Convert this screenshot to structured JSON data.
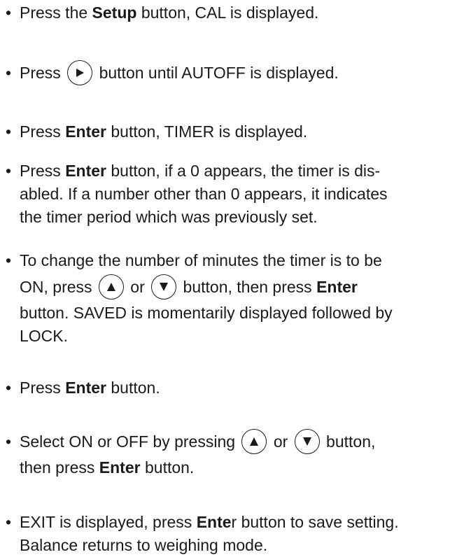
{
  "steps": [
    {
      "a": "Press the ",
      "b": "Setup",
      "c": " button, CAL is displayed."
    },
    {
      "a": "Press ",
      "icon": "right-arrow-icon",
      "c": " button until AUTOFF is displayed."
    },
    {
      "a": "Press ",
      "b": "Enter",
      "c": " button, TIMER is displayed."
    },
    {
      "a": "Press ",
      "b": "Enter",
      "c": " button, if a 0 appears, the timer is  dis-",
      "l2": "abled.  If a number other than 0 appears, it indicates",
      "l3": "the timer period which was previously set."
    },
    {
      "l1": "To change the number of minutes the timer is to be",
      "l2a": "ON, press ",
      "or": " or ",
      "l2c": " button, then press ",
      "l2b": "Enter",
      "l3": "button.  SAVED is momentarily displayed followed by",
      "l4": "LOCK."
    },
    {
      "a": "Press ",
      "b": "Enter",
      "c": " button."
    },
    {
      "a": "Select ON or OFF by pressing ",
      "or": " or ",
      "c": " button,",
      "l2a": "then press ",
      "l2b": "Enter",
      "l2c": " button."
    },
    {
      "a": "EXIT is displayed, press ",
      "b": "Ente",
      "c": "r button to save setting.",
      "l2": "Balance returns to weighing mode."
    }
  ],
  "bullet": "•",
  "icons": {
    "up": "up-arrow-icon",
    "down": "down-arrow-icon",
    "right": "right-arrow-icon"
  }
}
